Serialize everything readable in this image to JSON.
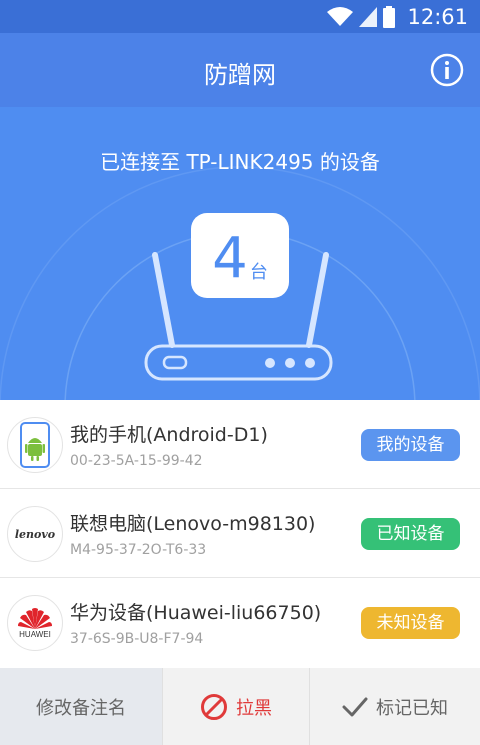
{
  "status_bar": {
    "time": "12:61",
    "icons": [
      "wifi-icon",
      "signal-icon",
      "battery-icon"
    ]
  },
  "app_bar": {
    "title": "防蹭网",
    "info_icon": "info-icon"
  },
  "hero": {
    "title": "已连接至 TP-LINK2495 的设备",
    "count": "4",
    "unit": "台"
  },
  "devices": [
    {
      "name": "我的手机(Android-D1)",
      "mac": "00-23-5A-15-99-42",
      "badge": "我的设备",
      "badge_color": "#4f8df1",
      "logo": "android-icon"
    },
    {
      "name": "联想电脑(Lenovo-m98130)",
      "mac": "M4-95-37-2O-T6-33",
      "badge": "已知设备",
      "badge_color": "#35c177",
      "logo": "lenovo-logo",
      "logo_text": "lenovo"
    },
    {
      "name": "华为设备(Huawei-liu66750)",
      "mac": "37-6S-9B-U8-F7-94",
      "badge": "未知设备",
      "badge_color": "#eeb730",
      "logo": "huawei-logo",
      "logo_text": "HUAWEI"
    }
  ],
  "bottom_bar": {
    "rename": "修改备注名",
    "block": "拉黑",
    "mark_known": "标记已知",
    "colors": {
      "block": "#e03a3a",
      "mark": "#666666"
    }
  }
}
